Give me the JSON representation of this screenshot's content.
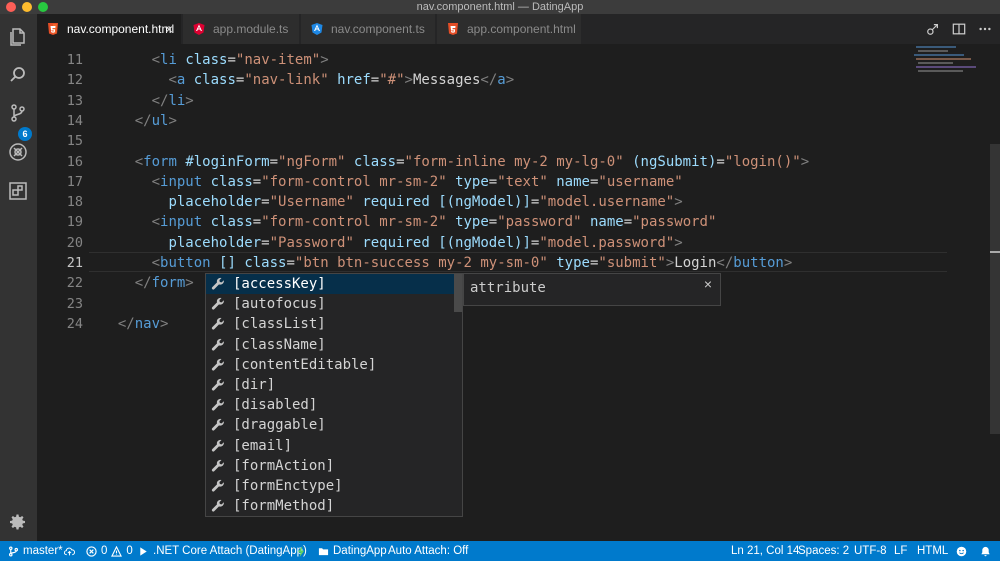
{
  "window": {
    "title": "nav.component.html — DatingApp"
  },
  "activity_bar": {
    "items": [
      {
        "name": "explorer-icon"
      },
      {
        "name": "search-icon"
      },
      {
        "name": "source-control-icon",
        "badge": "6"
      },
      {
        "name": "debug-icon"
      },
      {
        "name": "extensions-icon"
      }
    ],
    "bottom": {
      "name": "gear-icon"
    }
  },
  "tabs": [
    {
      "label": "nav.component.html",
      "icon": "html-file-icon",
      "active": true
    },
    {
      "label": "app.module.ts",
      "icon": "angular-file-icon",
      "active": false
    },
    {
      "label": "nav.component.ts",
      "icon": "angular-file-icon",
      "active": false
    },
    {
      "label": "app.component.html",
      "icon": "html-file-icon",
      "active": false
    }
  ],
  "tab_close_glyph": "×",
  "editor": {
    "current_line": 21,
    "lines": [
      {
        "n": "11",
        "indent": "      ",
        "tokens": [
          [
            "pun",
            "<"
          ],
          [
            "tag",
            "li"
          ],
          [
            "txt",
            " "
          ],
          [
            "attr",
            "class"
          ],
          [
            "txt",
            "="
          ],
          [
            "str",
            "\"nav-item\""
          ],
          [
            "pun",
            ">"
          ]
        ]
      },
      {
        "n": "12",
        "indent": "        ",
        "tokens": [
          [
            "pun",
            "<"
          ],
          [
            "tag",
            "a"
          ],
          [
            "txt",
            " "
          ],
          [
            "attr",
            "class"
          ],
          [
            "txt",
            "="
          ],
          [
            "str",
            "\"nav-link\""
          ],
          [
            "txt",
            " "
          ],
          [
            "attr",
            "href"
          ],
          [
            "txt",
            "="
          ],
          [
            "str",
            "\"#\""
          ],
          [
            "pun",
            ">"
          ],
          [
            "txt",
            "Messages"
          ],
          [
            "pun",
            "</"
          ],
          [
            "tag",
            "a"
          ],
          [
            "pun",
            ">"
          ]
        ]
      },
      {
        "n": "13",
        "indent": "      ",
        "tokens": [
          [
            "pun",
            "</"
          ],
          [
            "tag",
            "li"
          ],
          [
            "pun",
            ">"
          ]
        ]
      },
      {
        "n": "14",
        "indent": "    ",
        "tokens": [
          [
            "pun",
            "</"
          ],
          [
            "tag",
            "ul"
          ],
          [
            "pun",
            ">"
          ]
        ]
      },
      {
        "n": "15",
        "indent": "",
        "tokens": []
      },
      {
        "n": "16",
        "indent": "    ",
        "tokens": [
          [
            "pun",
            "<"
          ],
          [
            "tag",
            "form"
          ],
          [
            "txt",
            " "
          ],
          [
            "attr",
            "#loginForm"
          ],
          [
            "txt",
            "="
          ],
          [
            "str",
            "\"ngForm\""
          ],
          [
            "txt",
            " "
          ],
          [
            "attr",
            "class"
          ],
          [
            "txt",
            "="
          ],
          [
            "str",
            "\"form-inline my-2 my-lg-0\""
          ],
          [
            "txt",
            " "
          ],
          [
            "attr",
            "(ngSubmit)"
          ],
          [
            "txt",
            "="
          ],
          [
            "str",
            "\"login()\""
          ],
          [
            "pun",
            ">"
          ]
        ]
      },
      {
        "n": "17",
        "indent": "      ",
        "tokens": [
          [
            "pun",
            "<"
          ],
          [
            "tag",
            "input"
          ],
          [
            "txt",
            " "
          ],
          [
            "attr",
            "class"
          ],
          [
            "txt",
            "="
          ],
          [
            "str",
            "\"form-control mr-sm-2\""
          ],
          [
            "txt",
            " "
          ],
          [
            "attr",
            "type"
          ],
          [
            "txt",
            "="
          ],
          [
            "str",
            "\"text\""
          ],
          [
            "txt",
            " "
          ],
          [
            "attr",
            "name"
          ],
          [
            "txt",
            "="
          ],
          [
            "str",
            "\"username\""
          ]
        ]
      },
      {
        "n": "18",
        "indent": "        ",
        "tokens": [
          [
            "attr",
            "placeholder"
          ],
          [
            "txt",
            "="
          ],
          [
            "str",
            "\"Username\""
          ],
          [
            "txt",
            " "
          ],
          [
            "attr",
            "required"
          ],
          [
            "txt",
            " "
          ],
          [
            "attr",
            "[(ngModel)]"
          ],
          [
            "txt",
            "="
          ],
          [
            "str",
            "\"model.username\""
          ],
          [
            "pun",
            ">"
          ]
        ]
      },
      {
        "n": "19",
        "indent": "      ",
        "tokens": [
          [
            "pun",
            "<"
          ],
          [
            "tag",
            "input"
          ],
          [
            "txt",
            " "
          ],
          [
            "attr",
            "class"
          ],
          [
            "txt",
            "="
          ],
          [
            "str",
            "\"form-control mr-sm-2\""
          ],
          [
            "txt",
            " "
          ],
          [
            "attr",
            "type"
          ],
          [
            "txt",
            "="
          ],
          [
            "str",
            "\"password\""
          ],
          [
            "txt",
            " "
          ],
          [
            "attr",
            "name"
          ],
          [
            "txt",
            "="
          ],
          [
            "str",
            "\"password\""
          ]
        ]
      },
      {
        "n": "20",
        "indent": "        ",
        "tokens": [
          [
            "attr",
            "placeholder"
          ],
          [
            "txt",
            "="
          ],
          [
            "str",
            "\"Password\""
          ],
          [
            "txt",
            " "
          ],
          [
            "attr",
            "required"
          ],
          [
            "txt",
            " "
          ],
          [
            "attr",
            "[(ngModel)]"
          ],
          [
            "txt",
            "="
          ],
          [
            "str",
            "\"model.password\""
          ],
          [
            "pun",
            ">"
          ]
        ]
      },
      {
        "n": "21",
        "indent": "      ",
        "tokens": [
          [
            "pun",
            "<"
          ],
          [
            "tag",
            "button"
          ],
          [
            "txt",
            " "
          ],
          [
            "attr",
            "[]"
          ],
          [
            "txt",
            " "
          ],
          [
            "attr",
            "class"
          ],
          [
            "txt",
            "="
          ],
          [
            "str",
            "\"btn btn-success my-2 my-sm-0\""
          ],
          [
            "txt",
            " "
          ],
          [
            "attr",
            "type"
          ],
          [
            "txt",
            "="
          ],
          [
            "str",
            "\"submit\""
          ],
          [
            "pun",
            ">"
          ],
          [
            "txt",
            "Login"
          ],
          [
            "pun",
            "</"
          ],
          [
            "tag",
            "button"
          ],
          [
            "pun",
            ">"
          ]
        ]
      },
      {
        "n": "22",
        "indent": "    ",
        "tokens": [
          [
            "pun",
            "</"
          ],
          [
            "tag",
            "form"
          ],
          [
            "pun",
            ">"
          ]
        ]
      },
      {
        "n": "23",
        "indent": "",
        "tokens": []
      },
      {
        "n": "24",
        "indent": "  ",
        "tokens": [
          [
            "pun",
            "</"
          ],
          [
            "tag",
            "nav"
          ],
          [
            "pun",
            ">"
          ]
        ]
      }
    ]
  },
  "suggestions": {
    "selected_index": 0,
    "items": [
      "[accessKey]",
      "[autofocus]",
      "[classList]",
      "[className]",
      "[contentEditable]",
      "[dir]",
      "[disabled]",
      "[draggable]",
      "[email]",
      "[formAction]",
      "[formEnctype]",
      "[formMethod]"
    ],
    "detail": "attribute",
    "detail_close": "×"
  },
  "status_bar": {
    "branch": "master*",
    "errors": "0",
    "warnings": "0",
    "debug_config": ".NET Core Attach (DatingApp)",
    "folder": "DatingApp",
    "auto_attach": "Auto Attach: Off",
    "position": "Ln 21, Col 14",
    "spaces": "Spaces: 2",
    "encoding": "UTF-8",
    "eol": "LF",
    "language": "HTML"
  },
  "colors": {
    "accent": "#007acc",
    "selection": "#062f4a",
    "html_icon": "#e44d26",
    "angular_icon": "#dd0031"
  }
}
